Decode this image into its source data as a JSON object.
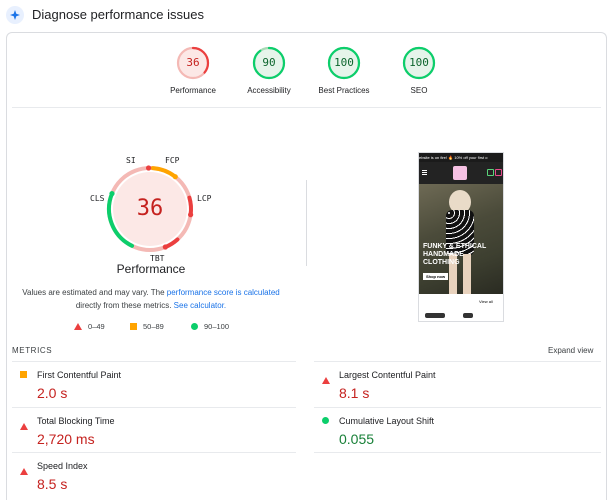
{
  "header": {
    "title": "Diagnose performance issues"
  },
  "colors": {
    "red": "#eb3f3f",
    "orange": "#ffa400",
    "green": "#0cce6b",
    "link": "#1a73e8"
  },
  "gauges": [
    {
      "score": "36",
      "label": "Performance",
      "color": "#eb3f3f",
      "fraction": 0.36
    },
    {
      "score": "90",
      "label": "Accessibility",
      "color": "#0cce6b",
      "fraction": 0.9
    },
    {
      "score": "100",
      "label": "Best Practices",
      "color": "#0cce6b",
      "fraction": 1.0
    },
    {
      "score": "100",
      "label": "SEO",
      "color": "#0cce6b",
      "fraction": 1.0
    }
  ],
  "performance": {
    "score": "36",
    "title": "Performance",
    "metric_labels": {
      "si": "SI",
      "fcp": "FCP",
      "lcp": "LCP",
      "tbt": "TBT",
      "cls": "CLS"
    },
    "note_prefix": "Values are estimated and may vary. The ",
    "note_link": "performance score is calculated",
    "note_mid": " directly from these metrics. ",
    "note_calc": "See calculator."
  },
  "legend": {
    "fail": "0–49",
    "average": "50–89",
    "pass": "90–100"
  },
  "screenshot": {
    "banner": "ebsite is on fire! 🔥 10% off your first o",
    "headline": "FUNKY & ETHICAL HANDMADE CLOTHING",
    "cta": "Shop now",
    "view_all": "View all"
  },
  "metrics": {
    "title": "METRICS",
    "expand": "Expand view",
    "items": [
      {
        "name": "First Contentful Paint",
        "value": "2.0 s",
        "status": "average"
      },
      {
        "name": "Largest Contentful Paint",
        "value": "8.1 s",
        "status": "fail"
      },
      {
        "name": "Total Blocking Time",
        "value": "2,720 ms",
        "status": "fail"
      },
      {
        "name": "Cumulative Layout Shift",
        "value": "0.055",
        "status": "pass"
      },
      {
        "name": "Speed Index",
        "value": "8.5 s",
        "status": "fail"
      }
    ]
  }
}
